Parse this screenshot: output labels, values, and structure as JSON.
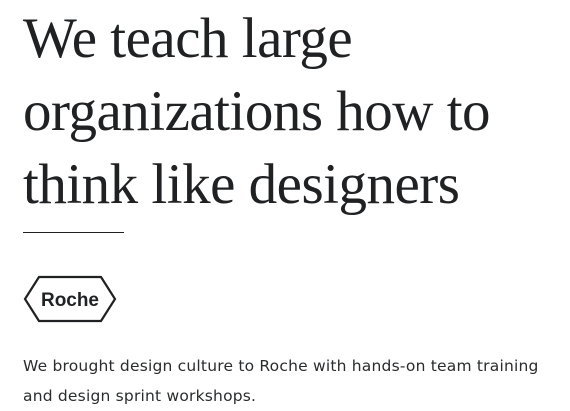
{
  "hero": {
    "headline_lines": [
      "We teach large",
      "organizations how to",
      "think like designers"
    ]
  },
  "client": {
    "logo_text": "Roche",
    "logo_icon": "roche-hexagon-logo"
  },
  "description_lines": [
    "We brought design culture to Roche with hands-on team training",
    "and design sprint workshops."
  ]
}
